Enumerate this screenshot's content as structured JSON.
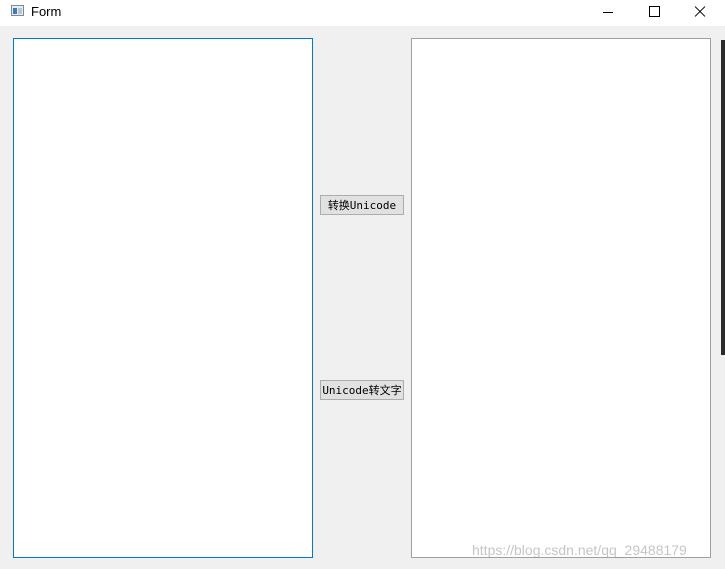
{
  "window": {
    "title": "Form",
    "icon": "form-window-icon"
  },
  "buttons": {
    "to_unicode": "转换Unicode",
    "from_unicode": "Unicode转文字"
  },
  "input_text": {
    "value": ""
  },
  "output_text": {
    "value": ""
  },
  "watermark": "https://blog.csdn.net/qq_29488179",
  "colors": {
    "focus_border": "#0078d7",
    "background": "#f0f0f0"
  }
}
